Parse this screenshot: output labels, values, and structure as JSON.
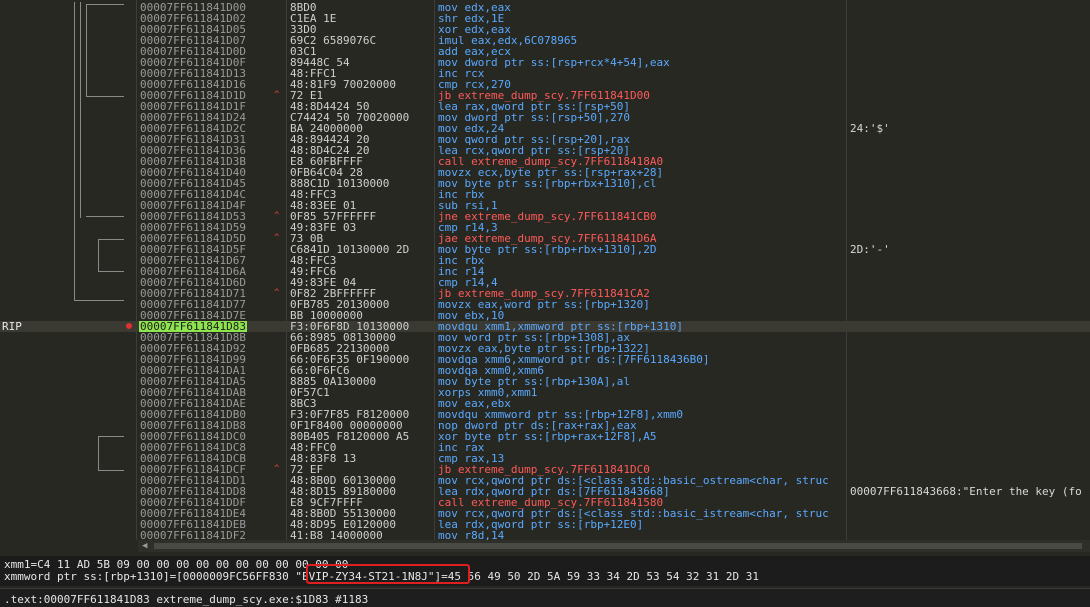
{
  "rows": [
    {
      "address": "00007FF611841D00",
      "bytes": "8BD0",
      "instruction": "mov edx,eax",
      "comment": "",
      "type": "normal"
    },
    {
      "address": "00007FF611841D02",
      "bytes": "C1EA 1E",
      "instruction": "shr edx,1E",
      "comment": "",
      "type": "normal"
    },
    {
      "address": "00007FF611841D05",
      "bytes": "33D0",
      "instruction": "xor edx,eax",
      "comment": "",
      "type": "normal"
    },
    {
      "address": "00007FF611841D07",
      "bytes": "69C2 6589076C",
      "instruction": "imul eax,edx,6C078965",
      "comment": "",
      "type": "normal"
    },
    {
      "address": "00007FF611841D0D",
      "bytes": "03C1",
      "instruction": "add eax,ecx",
      "comment": "",
      "type": "normal"
    },
    {
      "address": "00007FF611841D0F",
      "bytes": "89448C 54",
      "instruction": "mov dword ptr ss:[rsp+rcx*4+54],eax",
      "comment": "",
      "type": "normal"
    },
    {
      "address": "00007FF611841D13",
      "bytes": "48:FFC1",
      "instruction": "inc rcx",
      "comment": "",
      "type": "normal"
    },
    {
      "address": "00007FF611841D16",
      "bytes": "48:81F9 70020000",
      "instruction": "cmp rcx,270",
      "comment": "",
      "type": "normal"
    },
    {
      "address": "00007FF611841D1D",
      "bytes": "72 E1",
      "instruction": "jb extreme_dump_scy.7FF611841D00",
      "comment": "",
      "type": "jump"
    },
    {
      "address": "00007FF611841D1F",
      "bytes": "48:8D4424 50",
      "instruction": "lea rax,qword ptr ss:[rsp+50]",
      "comment": "",
      "type": "normal"
    },
    {
      "address": "00007FF611841D24",
      "bytes": "C74424 50 70020000",
      "instruction": "mov dword ptr ss:[rsp+50],270",
      "comment": "",
      "type": "normal"
    },
    {
      "address": "00007FF611841D2C",
      "bytes": "BA 24000000",
      "instruction": "mov edx,24",
      "comment": "24:'$'",
      "type": "normal"
    },
    {
      "address": "00007FF611841D31",
      "bytes": "48:894424 20",
      "instruction": "mov qword ptr ss:[rsp+20],rax",
      "comment": "",
      "type": "normal"
    },
    {
      "address": "00007FF611841D36",
      "bytes": "48:8D4C24 20",
      "instruction": "lea rcx,qword ptr ss:[rsp+20]",
      "comment": "",
      "type": "normal"
    },
    {
      "address": "00007FF611841D3B",
      "bytes": "E8 60FBFFFF",
      "instruction": "call extreme_dump_scy.7FF6118418A0",
      "comment": "",
      "type": "call"
    },
    {
      "address": "00007FF611841D40",
      "bytes": "0FB64C04 28",
      "instruction": "movzx ecx,byte ptr ss:[rsp+rax+28]",
      "comment": "",
      "type": "normal"
    },
    {
      "address": "00007FF611841D45",
      "bytes": "888C1D 10130000",
      "instruction": "mov byte ptr ss:[rbp+rbx+1310],cl",
      "comment": "",
      "type": "normal"
    },
    {
      "address": "00007FF611841D4C",
      "bytes": "48:FFC3",
      "instruction": "inc rbx",
      "comment": "",
      "type": "normal"
    },
    {
      "address": "00007FF611841D4F",
      "bytes": "48:83EE 01",
      "instruction": "sub rsi,1",
      "comment": "",
      "type": "normal"
    },
    {
      "address": "00007FF611841D53",
      "bytes": "0F85 57FFFFFF",
      "instruction": "jne extreme_dump_scy.7FF611841CB0",
      "comment": "",
      "type": "jump"
    },
    {
      "address": "00007FF611841D59",
      "bytes": "49:83FE 03",
      "instruction": "cmp r14,3",
      "comment": "",
      "type": "normal"
    },
    {
      "address": "00007FF611841D5D",
      "bytes": "73 0B",
      "instruction": "jae extreme_dump_scy.7FF611841D6A",
      "comment": "",
      "type": "jump"
    },
    {
      "address": "00007FF611841D5F",
      "bytes": "C6841D 10130000 2D",
      "instruction": "mov byte ptr ss:[rbp+rbx+1310],2D",
      "comment": "2D:'-'",
      "type": "normal"
    },
    {
      "address": "00007FF611841D67",
      "bytes": "48:FFC3",
      "instruction": "inc rbx",
      "comment": "",
      "type": "normal"
    },
    {
      "address": "00007FF611841D6A",
      "bytes": "49:FFC6",
      "instruction": "inc r14",
      "comment": "",
      "type": "normal"
    },
    {
      "address": "00007FF611841D6D",
      "bytes": "49:83FE 04",
      "instruction": "cmp r14,4",
      "comment": "",
      "type": "normal"
    },
    {
      "address": "00007FF611841D71",
      "bytes": "0F82 2BFFFFFF",
      "instruction": "jb extreme_dump_scy.7FF611841CA2",
      "comment": "",
      "type": "jump"
    },
    {
      "address": "00007FF611841D77",
      "bytes": "0FB785 20130000",
      "instruction": "movzx eax,word ptr ss:[rbp+1320]",
      "comment": "",
      "type": "normal"
    },
    {
      "address": "00007FF611841D7E",
      "bytes": "BB 10000000",
      "instruction": "mov ebx,10",
      "comment": "",
      "type": "normal"
    },
    {
      "address": "00007FF611841D83",
      "bytes": "F3:0F6F8D 10130000",
      "instruction": "movdqu xmm1,xmmword ptr ss:[rbp+1310]",
      "comment": "",
      "type": "current"
    },
    {
      "address": "00007FF611841D8B",
      "bytes": "66:8985 08130000",
      "instruction": "mov word ptr ss:[rbp+1308],ax",
      "comment": "",
      "type": "normal"
    },
    {
      "address": "00007FF611841D92",
      "bytes": "0FB685 22130000",
      "instruction": "movzx eax,byte ptr ss:[rbp+1322]",
      "comment": "",
      "type": "normal"
    },
    {
      "address": "00007FF611841D99",
      "bytes": "66:0F6F35 0F190000",
      "instruction": "movdqa xmm6,xmmword ptr ds:[7FF6118436B0]",
      "comment": "",
      "type": "normal"
    },
    {
      "address": "00007FF611841DA1",
      "bytes": "66:0F6FC6",
      "instruction": "movdqa xmm0,xmm6",
      "comment": "",
      "type": "normal"
    },
    {
      "address": "00007FF611841DA5",
      "bytes": "8885 0A130000",
      "instruction": "mov byte ptr ss:[rbp+130A],al",
      "comment": "",
      "type": "normal"
    },
    {
      "address": "00007FF611841DAB",
      "bytes": "0F57C1",
      "instruction": "xorps xmm0,xmm1",
      "comment": "",
      "type": "normal"
    },
    {
      "address": "00007FF611841DAE",
      "bytes": "8BC3",
      "instruction": "mov eax,ebx",
      "comment": "",
      "type": "normal"
    },
    {
      "address": "00007FF611841DB0",
      "bytes": "F3:0F7F85 F8120000",
      "instruction": "movdqu xmmword ptr ss:[rbp+12F8],xmm0",
      "comment": "",
      "type": "normal"
    },
    {
      "address": "00007FF611841DB8",
      "bytes": "0F1F8400 00000000",
      "instruction": "nop dword ptr ds:[rax+rax],eax",
      "comment": "",
      "type": "normal"
    },
    {
      "address": "00007FF611841DC0",
      "bytes": "80B405 F8120000 A5",
      "instruction": "xor byte ptr ss:[rbp+rax+12F8],A5",
      "comment": "",
      "type": "normal"
    },
    {
      "address": "00007FF611841DC8",
      "bytes": "48:FFC0",
      "instruction": "inc rax",
      "comment": "",
      "type": "normal"
    },
    {
      "address": "00007FF611841DCB",
      "bytes": "48:83F8 13",
      "instruction": "cmp rax,13",
      "comment": "",
      "type": "normal"
    },
    {
      "address": "00007FF611841DCF",
      "bytes": "72 EF",
      "instruction": "jb extreme_dump_scy.7FF611841DC0",
      "comment": "",
      "type": "jump"
    },
    {
      "address": "00007FF611841DD1",
      "bytes": "48:8B0D 60130000",
      "instruction": "mov rcx,qword ptr ds:[<class std::basic_ostream<char, struc",
      "comment": "",
      "type": "normal"
    },
    {
      "address": "00007FF611841DD8",
      "bytes": "48:8D15 89180000",
      "instruction": "lea rdx,qword ptr ds:[7FF611843668]",
      "comment": "00007FF611843668:\"Enter the key (fo",
      "type": "normal"
    },
    {
      "address": "00007FF611841DDF",
      "bytes": "E8 9CF7FFFF",
      "instruction": "call extreme_dump_scy.7FF611841580",
      "comment": "",
      "type": "call"
    },
    {
      "address": "00007FF611841DE4",
      "bytes": "48:8B0D 55130000",
      "instruction": "mov rcx,qword ptr ds:[<class std::basic_istream<char, struc",
      "comment": "",
      "type": "normal"
    },
    {
      "address": "00007FF611841DEB",
      "bytes": "48:8D95 E0120000",
      "instruction": "lea rdx,qword ptr ss:[rbp+12E0]",
      "comment": "",
      "type": "normal"
    },
    {
      "address": "00007FF611841DF2",
      "bytes": "41:B8 14000000",
      "instruction": "mov r8d,14",
      "comment": "",
      "type": "normal"
    }
  ],
  "rip_label": "RIP",
  "info": {
    "line1": "xmm1=C4 11 AD 5B 09 00 00 00 00 00 00 00 00 00 00 00",
    "line2": "xmmword ptr ss:[rbp+1310]=[0000009FC56FF830 \"EVIP-ZY34-ST21-1N8J\"]=45 56 49 50 2D 5A 59 33 34 2D 53 54 32 31 2D 31"
  },
  "status": {
    "text": ".text:00007FF611841D83 extreme_dump_scy.exe:$1D83 #1183"
  }
}
